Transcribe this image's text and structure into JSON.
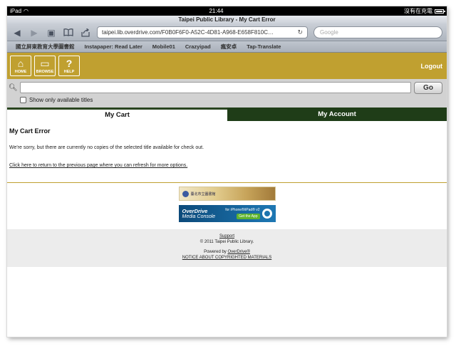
{
  "status_bar": {
    "device": "iPad",
    "time": "21:44",
    "battery_text": "沒有在充電"
  },
  "browser": {
    "page_title": "Taipei Public Library - My Cart Error",
    "url": "taipei.lib.overdrive.com/F0B0F6F0-A52C-4D81-A968-E658F810C…",
    "search_placeholder": "Google",
    "bookmarks": [
      "國立屏東教育大學圖書館",
      "Instapaper: Read Later",
      "Mobile01",
      "Crazyipad",
      "瘋安卓",
      "Tap-Translate"
    ]
  },
  "site_header": {
    "nav": [
      {
        "label": "HOME",
        "icon": "home-icon"
      },
      {
        "label": "BROWSE",
        "icon": "book-icon"
      },
      {
        "label": "HELP",
        "icon": "help-icon"
      }
    ],
    "logout_label": "Logout"
  },
  "search": {
    "go_label": "Go",
    "show_available_label": "Show only available titles"
  },
  "tabs": {
    "cart": "My Cart",
    "account": "My Account"
  },
  "content": {
    "heading": "My Cart Error",
    "message": "We're sorry, but there are currently no copies of the selected title available for check out.",
    "return_link": "Click here to return to the previous page where you can refresh for more options."
  },
  "banners": {
    "library_banner_text": "臺北市立圖書館",
    "overdrive_title": "OverDrive",
    "overdrive_subtitle": "Media Console",
    "overdrive_devices": "for iPhone®/iPad® v2",
    "overdrive_cta": "Get the App"
  },
  "footer": {
    "support": "Support",
    "copyright": "© 2011 Taipei Public Library.",
    "powered_prefix": "Powered by ",
    "powered_link": "OverDrive®",
    "notice": "NOTICE ABOUT COPYRIGHTED MATERIALS"
  }
}
